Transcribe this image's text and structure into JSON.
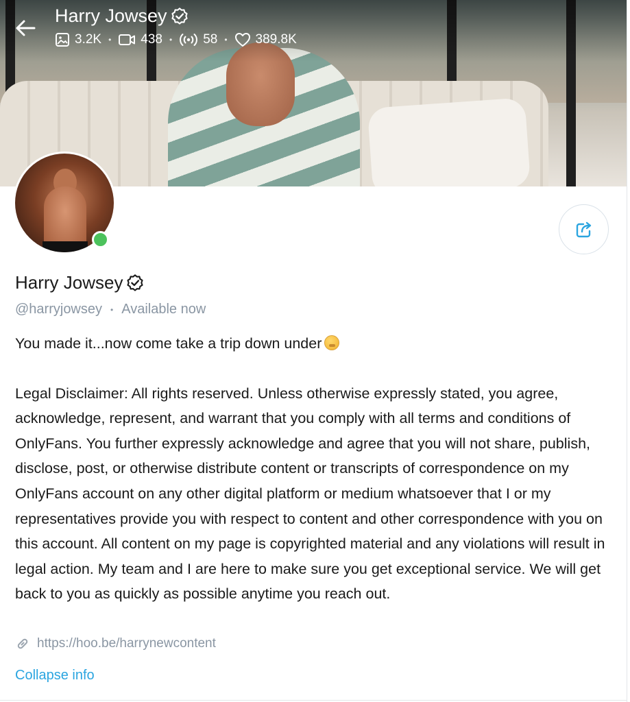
{
  "header": {
    "name": "Harry Jowsey",
    "stats": {
      "photos": "3.2K",
      "videos": "438",
      "streams": "58",
      "likes": "389.8K"
    }
  },
  "profile": {
    "name": "Harry Jowsey",
    "handle": "@harryjowsey",
    "status": "Available now",
    "online": true
  },
  "bio": {
    "intro": "You made it...now come take a trip down under",
    "disclaimer": "Legal Disclaimer: All rights reserved. Unless otherwise expressly stated, you agree, acknowledge, represent, and warrant that you comply with all terms and conditions of OnlyFans. You further expressly acknowledge and agree that you will not share, publish, disclose, post, or otherwise distribute content or transcripts of correspondence on my OnlyFans account on any other digital platform or medium whatsoever that I or my representatives provide you with respect to content and other correspondence with you on this account. All content on my page is copyrighted material and any violations will result in legal action. My team and I are here to make sure you get exceptional service. We will get back to you as quickly as possible anytime you reach out."
  },
  "link": {
    "url": "https://hoo.be/harrynewcontent"
  },
  "actions": {
    "collapse_label": "Collapse info"
  },
  "icons": {
    "back": "arrow-left-icon",
    "verified": "verified-badge-icon",
    "photos": "image-icon",
    "videos": "video-camera-icon",
    "streams": "broadcast-icon",
    "likes": "heart-icon",
    "share": "share-icon",
    "link": "link-icon",
    "emoji": "hand-over-mouth-emoji"
  },
  "colors": {
    "accent": "#2ba5e0",
    "online": "#4cc25c",
    "muted": "#8a96a3",
    "text": "#1a1a1a"
  }
}
